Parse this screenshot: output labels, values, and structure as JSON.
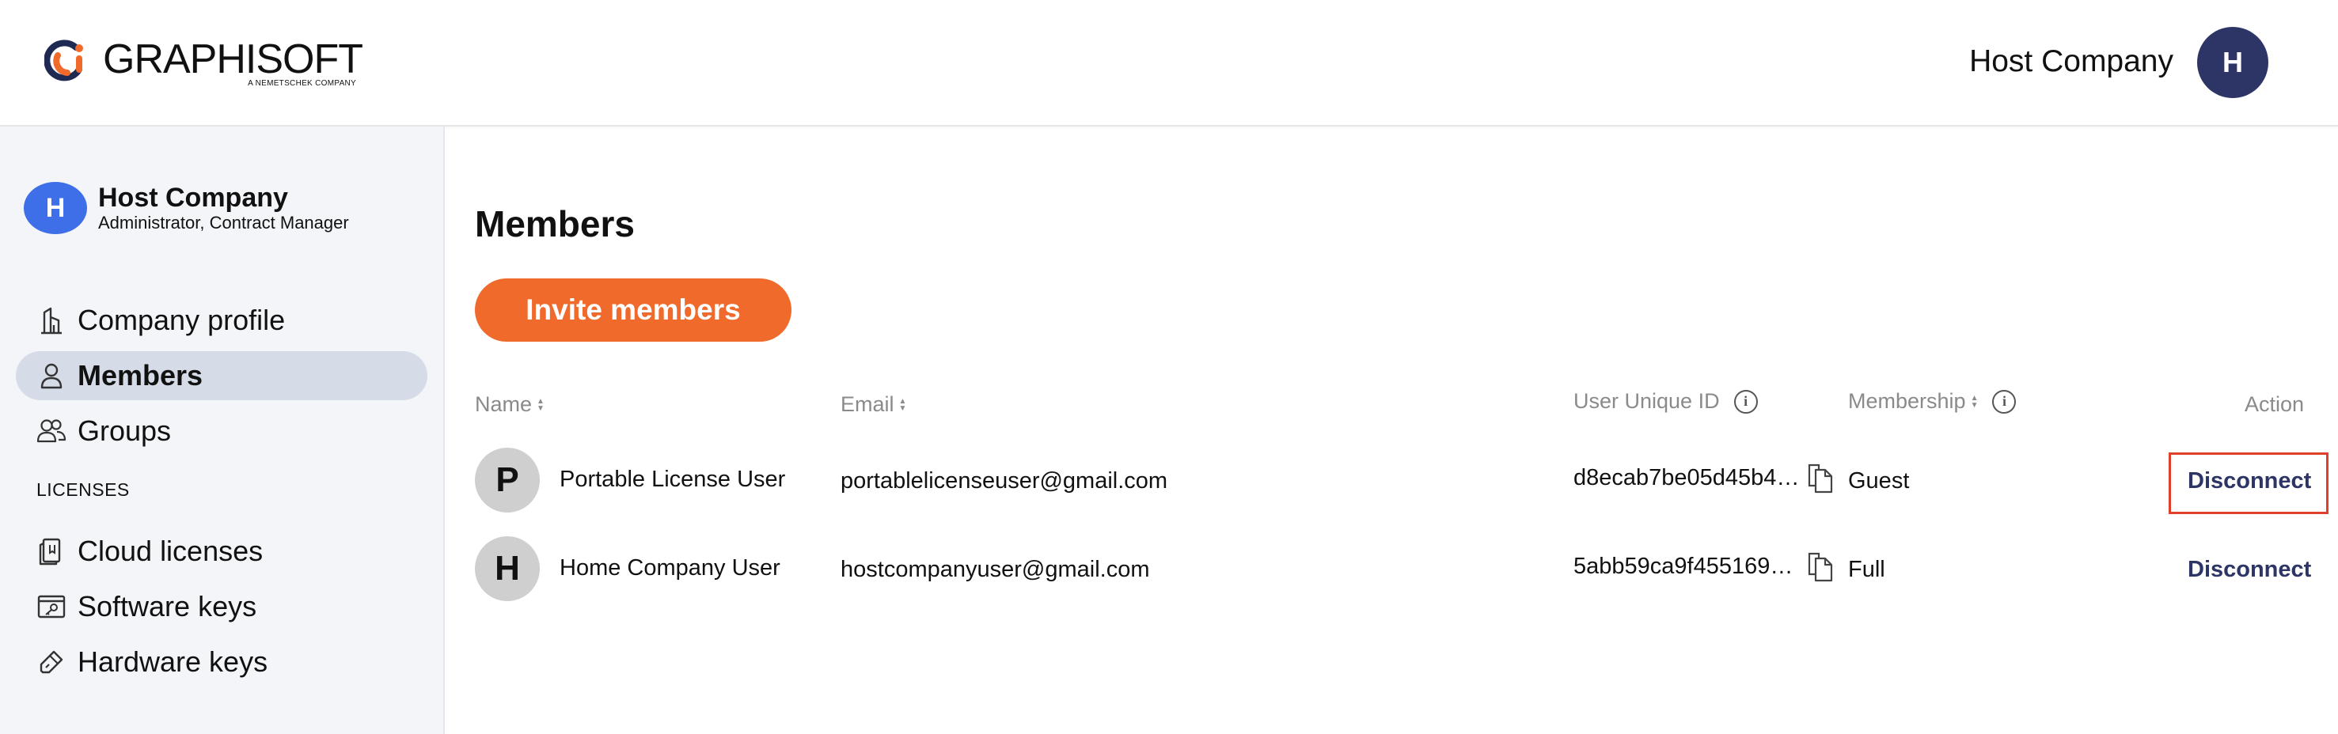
{
  "header": {
    "logo_text": "GRAPHISOFT",
    "logo_subtext": "A NEMETSCHEK COMPANY",
    "company_name": "Host Company",
    "avatar_initial": "H"
  },
  "sidebar": {
    "org": {
      "initial": "H",
      "name": "Host Company",
      "role": "Administrator, Contract Manager"
    },
    "items": [
      {
        "label": "Company profile",
        "icon": "building-icon"
      },
      {
        "label": "Members",
        "icon": "person-icon",
        "active": true
      },
      {
        "label": "Groups",
        "icon": "people-icon"
      }
    ],
    "section_label": "LICENSES",
    "license_items": [
      {
        "label": "Cloud licenses",
        "icon": "cloud-license-icon"
      },
      {
        "label": "Software keys",
        "icon": "software-key-icon"
      },
      {
        "label": "Hardware keys",
        "icon": "hardware-key-icon"
      }
    ]
  },
  "main": {
    "title": "Members",
    "invite_button": "Invite members",
    "table": {
      "headers": {
        "name": "Name",
        "email": "Email",
        "uid": "User Unique ID",
        "membership": "Membership",
        "action": "Action"
      },
      "rows": [
        {
          "initial": "P",
          "name": "Portable License User",
          "email": "portablelicenseuser@gmail.com",
          "uid": "d8ecab7be05d45b46…",
          "membership": "Guest",
          "action": "Disconnect"
        },
        {
          "initial": "H",
          "name": "Home Company User",
          "email": "hostcompanyuser@gmail.com",
          "uid": "5abb59ca9f455169c…",
          "membership": "Full",
          "action": "Disconnect"
        }
      ]
    }
  },
  "colors": {
    "accent_orange": "#ef6a2b",
    "navy": "#2d3566",
    "org_blue": "#3f6fe8",
    "highlight_red": "#e0402a"
  }
}
